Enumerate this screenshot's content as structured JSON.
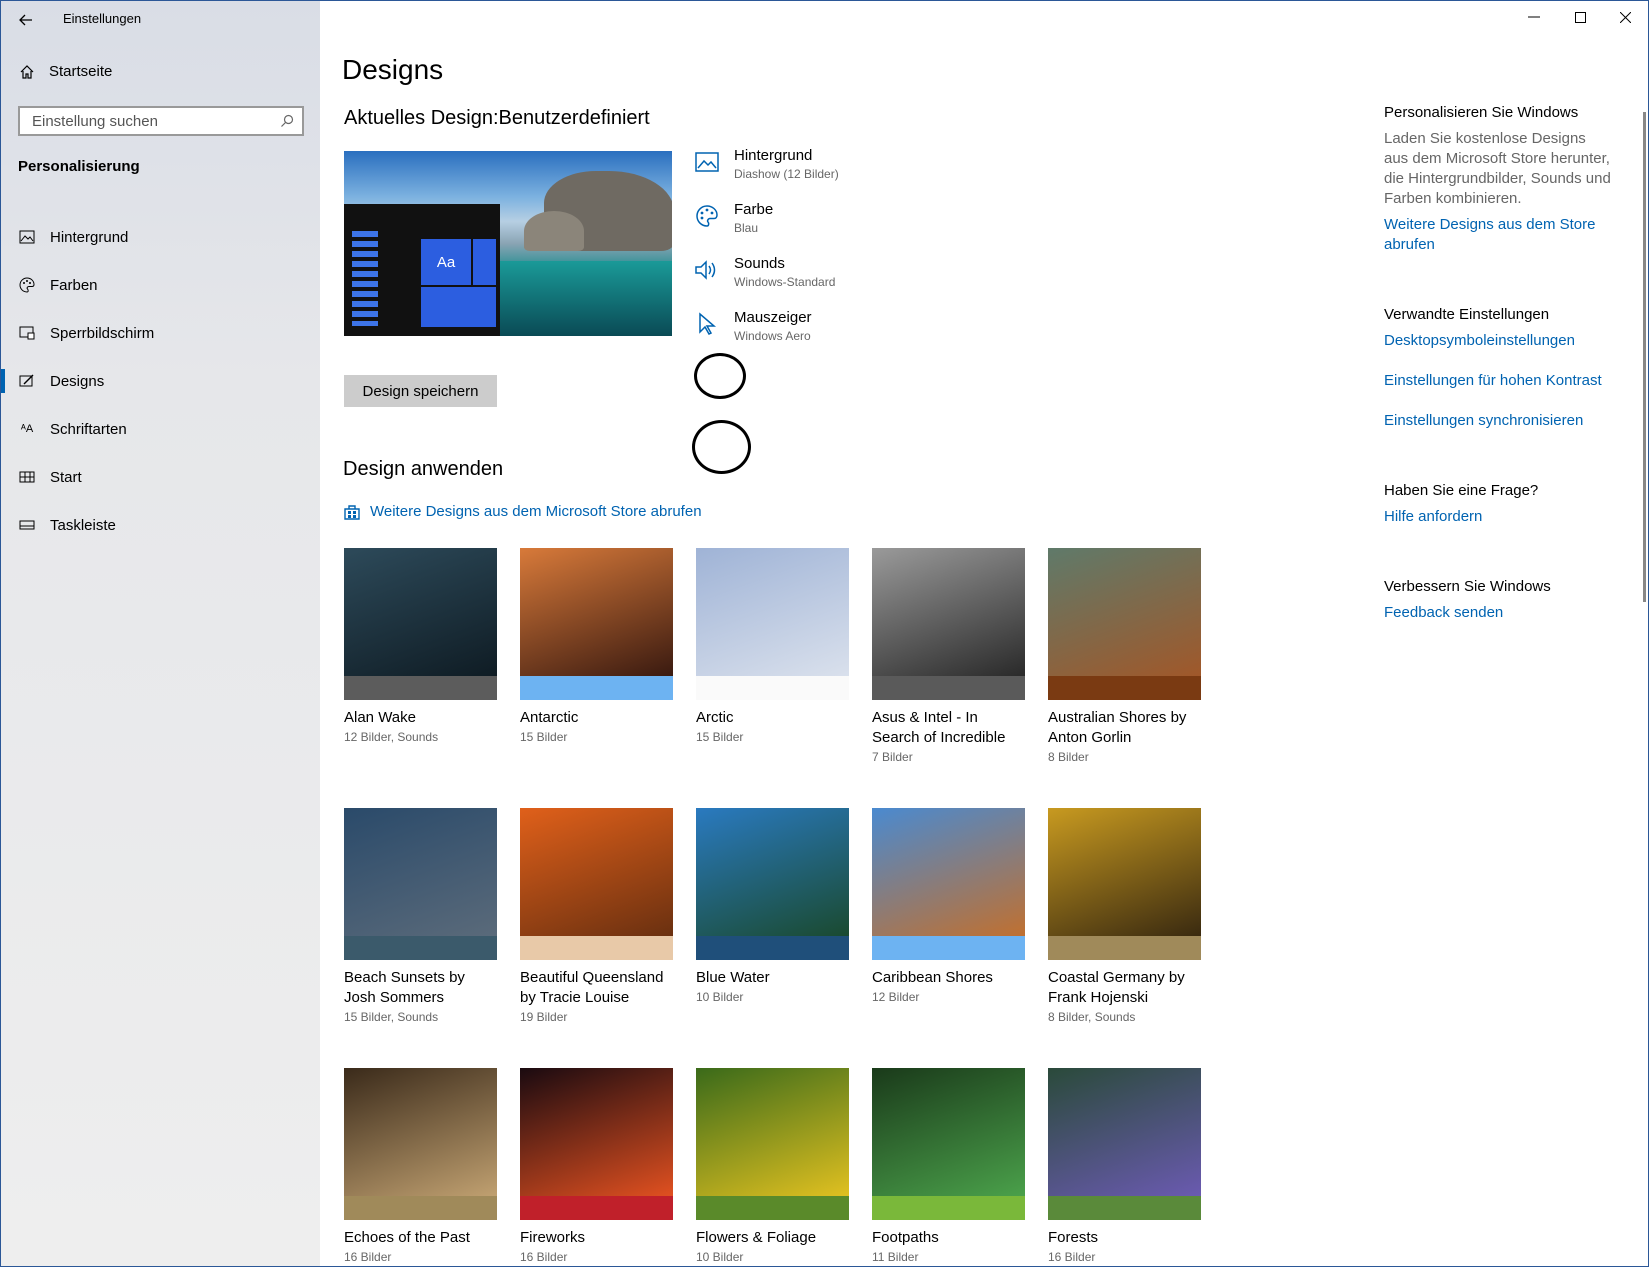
{
  "window": {
    "title": "Einstellungen",
    "controls": {
      "minimize": "—",
      "maximize": "☐",
      "close": "✕"
    }
  },
  "sidebar": {
    "home_label": "Startseite",
    "search_placeholder": "Einstellung suchen",
    "section_title": "Personalisierung",
    "items": [
      {
        "label": "Hintergrund",
        "icon": "image-icon"
      },
      {
        "label": "Farben",
        "icon": "palette-icon"
      },
      {
        "label": "Sperrbildschirm",
        "icon": "lock-screen-icon"
      },
      {
        "label": "Designs",
        "icon": "designs-icon",
        "active": true
      },
      {
        "label": "Schriftarten",
        "icon": "fonts-icon"
      },
      {
        "label": "Start",
        "icon": "start-icon"
      },
      {
        "label": "Taskleiste",
        "icon": "taskbar-icon"
      }
    ]
  },
  "main": {
    "page_title": "Designs",
    "current_design_label": "Aktuelles Design:Benutzerdefiniert",
    "attributes": [
      {
        "name": "Hintergrund",
        "value": "Diashow (12 Bilder)",
        "icon": "image-icon"
      },
      {
        "name": "Farbe",
        "value": "Blau",
        "icon": "palette-icon"
      },
      {
        "name": "Sounds",
        "value": "Windows-Standard",
        "icon": "speaker-icon"
      },
      {
        "name": "Mauszeiger",
        "value": "Windows Aero",
        "icon": "cursor-icon"
      }
    ],
    "preview_tile_label": "Aa",
    "save_button": "Design speichern",
    "apply_title": "Design anwenden",
    "store_link": "Weitere Designs aus dem Microsoft Store abrufen",
    "themes": [
      {
        "title": "Alan Wake",
        "sub": "12 Bilder, Sounds",
        "band": "#5c5c5c",
        "img": [
          "#2d4a5a",
          "#0f1c24"
        ]
      },
      {
        "title": "Antarctic",
        "sub": "15 Bilder",
        "band": "#6db3f2",
        "img": [
          "#d87a3a",
          "#3a1a10"
        ]
      },
      {
        "title": "Arctic",
        "sub": "15 Bilder",
        "band": "#fafafa",
        "img": [
          "#9fb3d6",
          "#d9e0ec"
        ]
      },
      {
        "title": "Asus & Intel - In Search of Incredible",
        "sub": "7 Bilder",
        "band": "#5a5a5a",
        "img": [
          "#9a9a9a",
          "#2a2a2a"
        ]
      },
      {
        "title": "Australian Shores by Anton Gorlin",
        "sub": "8 Bilder",
        "band": "#7a3a12",
        "img": [
          "#5f7a6a",
          "#a0582a"
        ]
      },
      {
        "title": "Beach Sunsets by Josh Sommers",
        "sub": "15 Bilder, Sounds",
        "band": "#3b5a6b",
        "img": [
          "#2a4a6a",
          "#5a6a7a"
        ]
      },
      {
        "title": "Beautiful Queensland by Tracie Louise",
        "sub": "19 Bilder",
        "band": "#e8c9a8",
        "img": [
          "#e0601a",
          "#6a3010"
        ]
      },
      {
        "title": "Blue Water",
        "sub": "10 Bilder",
        "band": "#1f4f7a",
        "img": [
          "#2a7ac0",
          "#1a4a30"
        ]
      },
      {
        "title": "Caribbean Shores",
        "sub": "12 Bilder",
        "band": "#6db3f2",
        "img": [
          "#4a8ad0",
          "#c07030"
        ]
      },
      {
        "title": "Coastal Germany by Frank Hojenski",
        "sub": "8 Bilder, Sounds",
        "band": "#a08a5a",
        "img": [
          "#c89a20",
          "#3a2a10"
        ]
      },
      {
        "title": "Echoes of the Past",
        "sub": "16 Bilder",
        "band": "#a08a5a",
        "img": [
          "#3a2a1a",
          "#c0a070"
        ]
      },
      {
        "title": "Fireworks",
        "sub": "16 Bilder",
        "band": "#c0202a",
        "img": [
          "#1a0a10",
          "#e05020"
        ]
      },
      {
        "title": "Flowers & Foliage",
        "sub": "10 Bilder",
        "band": "#5a8a2a",
        "img": [
          "#3a6a1a",
          "#e0c020"
        ]
      },
      {
        "title": "Footpaths",
        "sub": "11 Bilder",
        "band": "#7ab83a",
        "img": [
          "#1a3a1a",
          "#4aa04a"
        ]
      },
      {
        "title": "Forests",
        "sub": "16 Bilder",
        "band": "#5a8a3a",
        "img": [
          "#2a4a3a",
          "#6a5ab0"
        ]
      }
    ]
  },
  "right_panel": {
    "personalize_heading": "Personalisieren Sie Windows",
    "personalize_text": "Laden Sie kostenlose Designs aus dem Microsoft Store herunter, die Hintergrundbilder, Sounds und Farben kombinieren.",
    "personalize_link": "Weitere Designs aus dem Store abrufen",
    "related_heading": "Verwandte Einstellungen",
    "related_links": [
      "Desktopsymboleinstellungen",
      "Einstellungen für hohen Kontrast",
      "Einstellungen synchronisieren"
    ],
    "question_heading": "Haben Sie eine Frage?",
    "question_link": "Hilfe anfordern",
    "improve_heading": "Verbessern Sie Windows",
    "improve_link": "Feedback senden"
  },
  "colors": {
    "accent": "#0063b1",
    "link": "#0063b1"
  }
}
